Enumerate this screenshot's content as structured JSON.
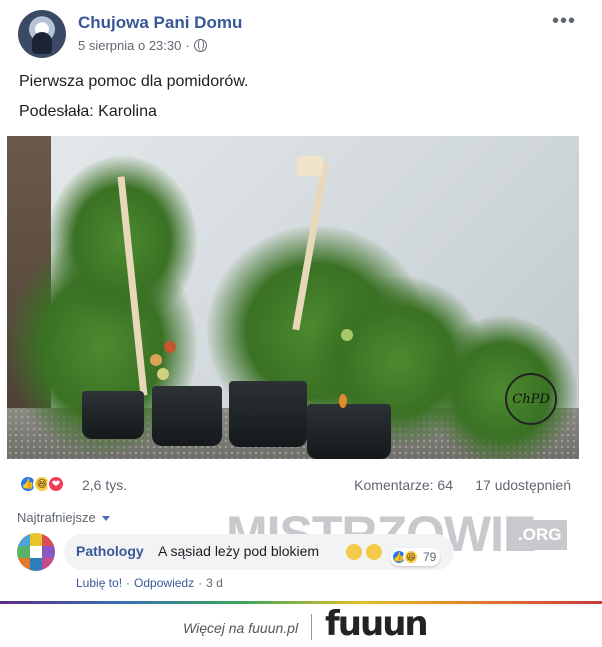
{
  "post": {
    "page_name": "Chujowa Pani Domu",
    "timestamp": "5 sierpnia o 23:30",
    "privacy_icon": "globe-icon",
    "more_icon": "more-options-icon",
    "more_label": "•••",
    "text_line1": "Pierwsza pomoc dla pomidorów.",
    "text_line2": "Podesłała: Karolina",
    "image_watermark": "ChPD"
  },
  "reactions": {
    "icons": [
      "like-icon",
      "haha-icon",
      "love-icon"
    ],
    "count": "2,6 tys.",
    "comments": "Komentarze: 64",
    "shares": "17 udostępnień"
  },
  "comments_section": {
    "sort_label": "Najtrafniejsze",
    "overlay_watermark": "MISTRZOWIE",
    "overlay_watermark_tld": ".ORG",
    "comment": {
      "author": "Pathology",
      "text": "A sąsiad leży pod blokiem",
      "reaction_count": "79",
      "actions": [
        "Lubię to!",
        "Odpowiedz",
        "3 d"
      ],
      "separator": "·"
    }
  },
  "footer": {
    "more_text": "Więcej na fuuun.pl",
    "logo": "fuuun"
  },
  "colors": {
    "link_blue": "#385898",
    "like_blue": "#2078f4",
    "love_red": "#f33e58",
    "haha_yellow": "#f7c948"
  }
}
